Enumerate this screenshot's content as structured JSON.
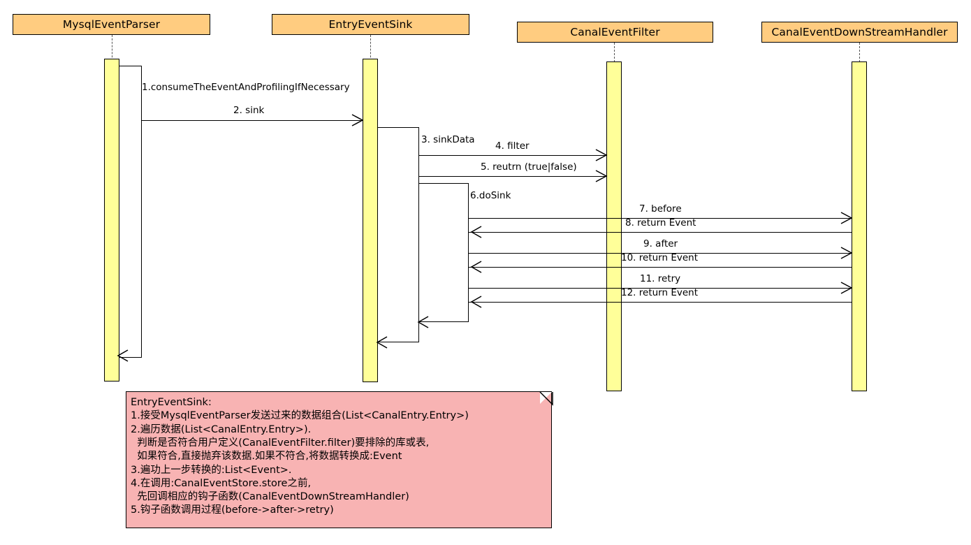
{
  "diagram": {
    "type": "uml-sequence-diagram",
    "title": "EntryEventSink sequence",
    "colors": {
      "actor_fill": "#FFCC80",
      "activation_fill": "#FFFF99",
      "note_fill": "#F8B3B3",
      "stroke": "#000000",
      "lifeline": "#555555"
    }
  },
  "participants": [
    {
      "id": "mysql-event-parser",
      "label": "MysqlEventParser"
    },
    {
      "id": "entry-event-sink",
      "label": "EntryEventSink"
    },
    {
      "id": "canal-event-filter",
      "label": "CanalEventFilter"
    },
    {
      "id": "canal-event-down-stream-handler",
      "label": "CanalEventDownStreamHandler"
    }
  ],
  "messages": [
    {
      "num": "1",
      "label": "1.consumeTheEventAndProfilingIfNecessary",
      "kind": "self-call"
    },
    {
      "num": "2",
      "label": "2. sink",
      "kind": "call"
    },
    {
      "num": "3",
      "label": "3. sinkData",
      "kind": "self-call"
    },
    {
      "num": "4",
      "label": "4. filter",
      "kind": "call"
    },
    {
      "num": "5",
      "label": "5. reutrn (true|false)",
      "kind": "call"
    },
    {
      "num": "6",
      "label": "6.doSink",
      "kind": "self-call"
    },
    {
      "num": "7",
      "label": "7. before",
      "kind": "call"
    },
    {
      "num": "8",
      "label": "8. return Event",
      "kind": "return"
    },
    {
      "num": "9",
      "label": "9. after",
      "kind": "call"
    },
    {
      "num": "10",
      "label": "10. return Event",
      "kind": "return"
    },
    {
      "num": "11",
      "label": "11. retry",
      "kind": "call"
    },
    {
      "num": "12",
      "label": "12. return Event",
      "kind": "return"
    }
  ],
  "note": {
    "target": "entry-event-sink",
    "lines": [
      "EntryEventSink:",
      "1.接受MysqlEventParser发送过来的数据组合(List<CanalEntry.Entry>)",
      "2.遍历数据(List<CanalEntry.Entry>).",
      "  判断是否符合用户定义(CanalEventFilter.filter)要排除的库或表,",
      "  如果符合,直接抛弃该数据.如果不符合,将数据转换成:Event",
      "3.遍功上一步转换的:List<Event>.",
      "4.在调用:CanalEventStore.store之前,",
      "  先回调相应的钩子函数(CanalEventDownStreamHandler)",
      "5.钩子函数调用过程(before->after->retry)"
    ]
  }
}
